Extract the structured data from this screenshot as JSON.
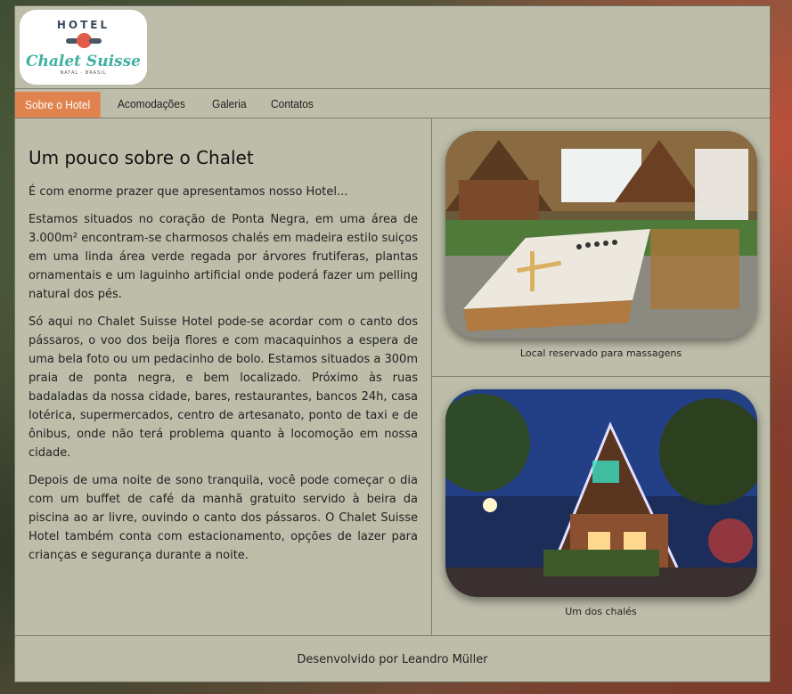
{
  "brand": {
    "logo_top": "HOTEL",
    "logo_name": "Chalet Suisse",
    "logo_sub": "NATAL · BRASIL"
  },
  "nav": {
    "items": [
      {
        "label": "Sobre o Hotel"
      },
      {
        "label": "Acomodações"
      },
      {
        "label": "Galeria"
      },
      {
        "label": "Contatos"
      }
    ]
  },
  "main": {
    "title": "Um pouco sobre o Chalet",
    "paragraphs": [
      "É com enorme prazer que apresentamos nosso Hotel...",
      "Estamos situados no coração de Ponta Negra, em uma área de 3.000m² encontram-se charmosos chalés em madeira estilo suiços em uma linda área verde regada por árvores frutiferas, plantas ornamentais e um laguinho artificial onde poderá fazer um pelling natural dos pés.",
      "Só aqui no Chalet Suisse Hotel pode-se acordar com o canto dos pássaros, o voo dos beija flores e com macaquinhos a espera de uma bela foto ou um pedacinho de bolo. Estamos situados a 300m praia de ponta negra, e bem localizado. Próximo às ruas badaladas da nossa cidade, bares, restaurantes, bancos 24h, casa lotérica, supermercados, centro de artesanato, ponto de taxi e de ônibus, onde não terá problema quanto à locomoção em nossa cidade.",
      "Depois de uma noite de sono tranquila, você pode começar o dia com um buffet de café da manhã gratuito servido à beira da piscina ao ar livre, ouvindo o canto dos pássaros. O Chalet Suisse Hotel também conta com estacionamento, opções de lazer para crianças e segurança durante a noite."
    ]
  },
  "aside": {
    "figures": [
      {
        "caption": "Local reservado para massagens"
      },
      {
        "caption": "Um dos chalés"
      }
    ]
  },
  "footer": {
    "text": "Desenvolvido por Leandro Müller"
  },
  "colors": {
    "panel": "#bdbdaa",
    "nav_active": "#e0834e"
  }
}
